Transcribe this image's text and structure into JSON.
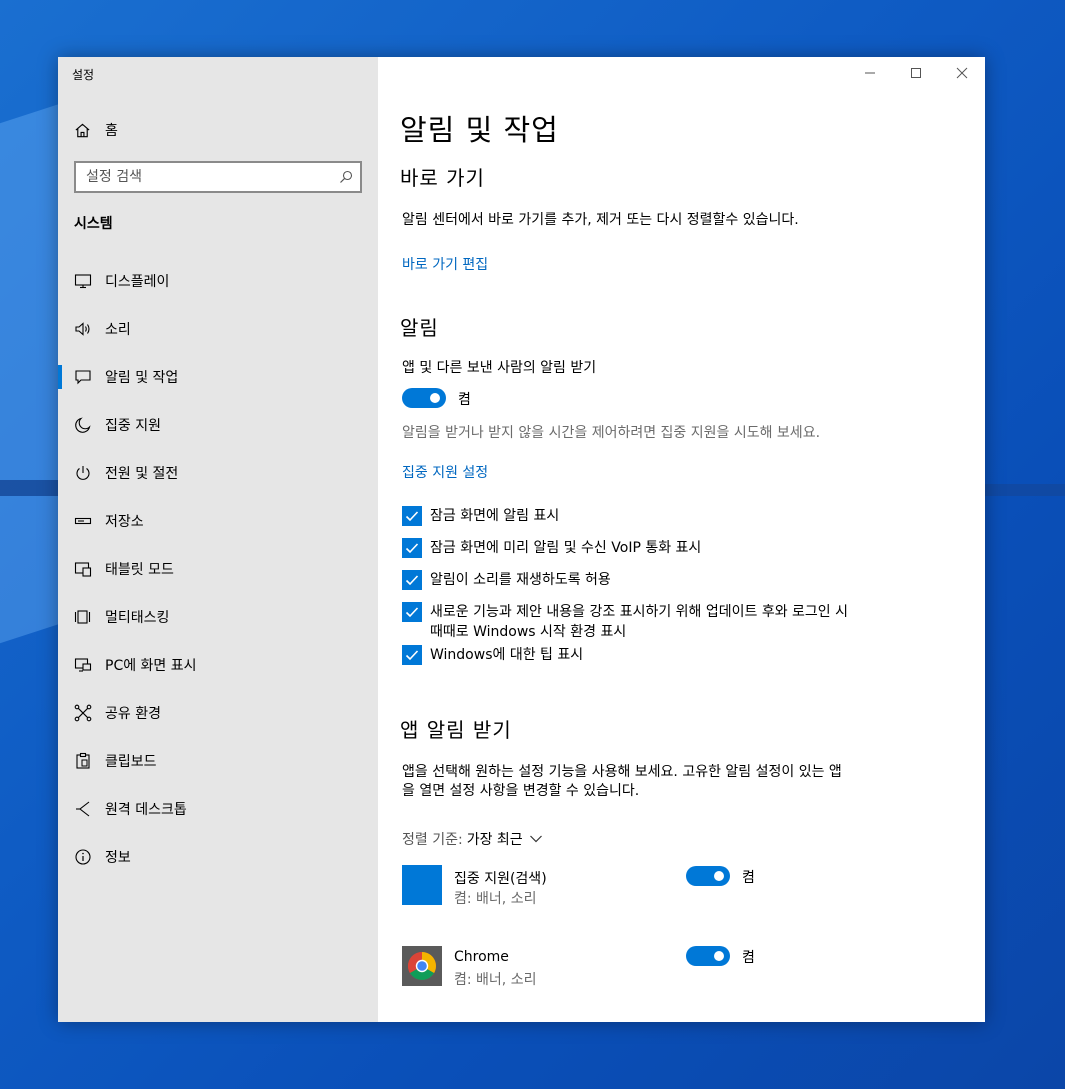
{
  "window": {
    "title": "설정"
  },
  "sidebar": {
    "home_label": "홈",
    "search_placeholder": "설정 검색",
    "section_title": "시스템",
    "items": [
      {
        "label": "디스플레이",
        "icon": "monitor-icon"
      },
      {
        "label": "소리",
        "icon": "speaker-icon"
      },
      {
        "label": "알림 및 작업",
        "icon": "notification-icon",
        "active": true
      },
      {
        "label": "집중 지원",
        "icon": "moon-icon"
      },
      {
        "label": "전원 및 절전",
        "icon": "power-icon"
      },
      {
        "label": "저장소",
        "icon": "storage-icon"
      },
      {
        "label": "태블릿 모드",
        "icon": "tablet-icon"
      },
      {
        "label": "멀티태스킹",
        "icon": "multitasking-icon"
      },
      {
        "label": "PC에 화면 표시",
        "icon": "project-icon"
      },
      {
        "label": "공유 환경",
        "icon": "share-icon"
      },
      {
        "label": "클립보드",
        "icon": "clipboard-icon"
      },
      {
        "label": "원격 데스크톱",
        "icon": "remote-desktop-icon"
      },
      {
        "label": "정보",
        "icon": "info-icon"
      }
    ]
  },
  "main": {
    "title": "알림 및 작업",
    "quick_actions": {
      "heading": "바로 가기",
      "description": "알림 센터에서 바로 가기를 추가, 제거 또는 다시 정렬할수 있습니다.",
      "edit_link": "바로 가기 편집"
    },
    "notifications": {
      "heading": "알림",
      "get_notifications_label": "앱 및 다른 보낸 사람의 알림 받기",
      "toggle_state": "켬",
      "focus_hint": "알림을 받거나 받지 않을 시간을 제어하려면 집중 지원을 시도해 보세요.",
      "focus_link": "집중 지원 설정",
      "checkboxes": [
        {
          "label": "잠금 화면에 알림 표시",
          "checked": true
        },
        {
          "label": "잠금 화면에 미리 알림 및 수신 VoIP 통화 표시",
          "checked": true
        },
        {
          "label": "알림이 소리를 재생하도록 허용",
          "checked": true
        },
        {
          "label": "새로운 기능과 제안 내용을 강조 표시하기 위해 업데이트 후와 로그인 시 때때로 Windows 시작 환경 표시",
          "checked": true
        },
        {
          "label": "Windows에 대한 팁 표시",
          "checked": true
        }
      ]
    },
    "app_notifications": {
      "heading": "앱 알림 받기",
      "description": "앱을 선택해 원하는 설정 기능을 사용해 보세요. 고유한 알림 설정이 있는 앱을 열면 설정 사항을 변경할 수 있습니다.",
      "sort_label": "정렬 기준:",
      "sort_value": "가장 최근",
      "apps": [
        {
          "name": "집중 지원(검색)",
          "detail": "켬: 배너, 소리",
          "toggle_state": "켬",
          "icon_color": "#0078d7"
        },
        {
          "name": "Chrome",
          "detail": "켬: 배너, 소리",
          "toggle_state": "켬",
          "icon_color": "#5a5a5a"
        }
      ]
    }
  },
  "colors": {
    "accent": "#0078d7",
    "link": "#0067c0",
    "sidebar_bg": "#e6e6e6"
  }
}
